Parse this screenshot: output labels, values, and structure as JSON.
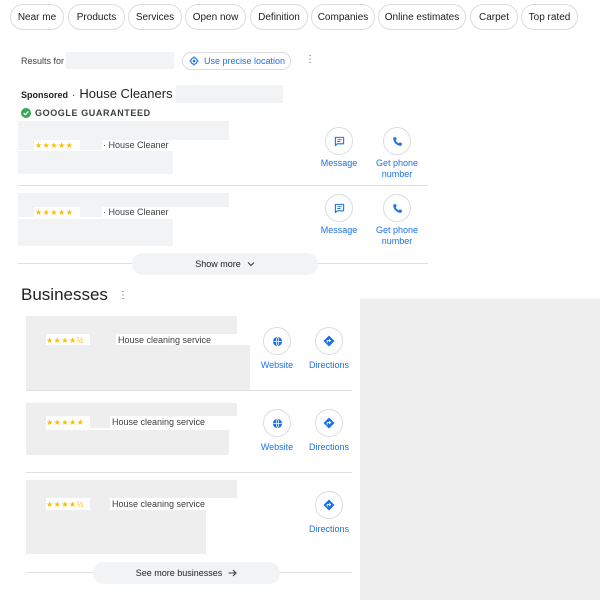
{
  "filter_chips": [
    {
      "label": "Near me"
    },
    {
      "label": "Products"
    },
    {
      "label": "Services"
    },
    {
      "label": "Open now"
    },
    {
      "label": "Definition"
    },
    {
      "label": "Companies"
    },
    {
      "label": "Online estimates"
    },
    {
      "label": "Carpet"
    },
    {
      "label": "Top rated"
    }
  ],
  "location_bar": {
    "results_for_label": "Results for",
    "precise_location_label": "Use precise location"
  },
  "sponsored": {
    "sponsored_label": "Sponsored",
    "separator": "·",
    "title": "House Cleaners |",
    "guaranteed_label": "GOOGLE GUARANTEED",
    "ads": [
      {
        "stars": "★★★★★",
        "category": "· House Cleaner",
        "message_label": "Message",
        "phone_label": "Get phone number"
      },
      {
        "stars": "★★★★★",
        "category": "· House Cleaner",
        "message_label": "Message",
        "phone_label": "Get phone number"
      }
    ],
    "show_more_label": "Show more"
  },
  "businesses": {
    "heading": "Businesses",
    "items": [
      {
        "stars": "★★★★½",
        "category": "House cleaning service",
        "website_label": "Website",
        "directions_label": "Directions"
      },
      {
        "stars": "★★★★★",
        "category": "House cleaning service",
        "website_label": "Website",
        "directions_label": "Directions"
      },
      {
        "stars": "★★★★½",
        "category": "House cleaning service",
        "directions_label": "Directions"
      }
    ],
    "see_more_label": "See more businesses"
  },
  "colors": {
    "accent": "#1a73e8",
    "star": "#fbbc04",
    "guaranteed_green": "#34a853"
  }
}
